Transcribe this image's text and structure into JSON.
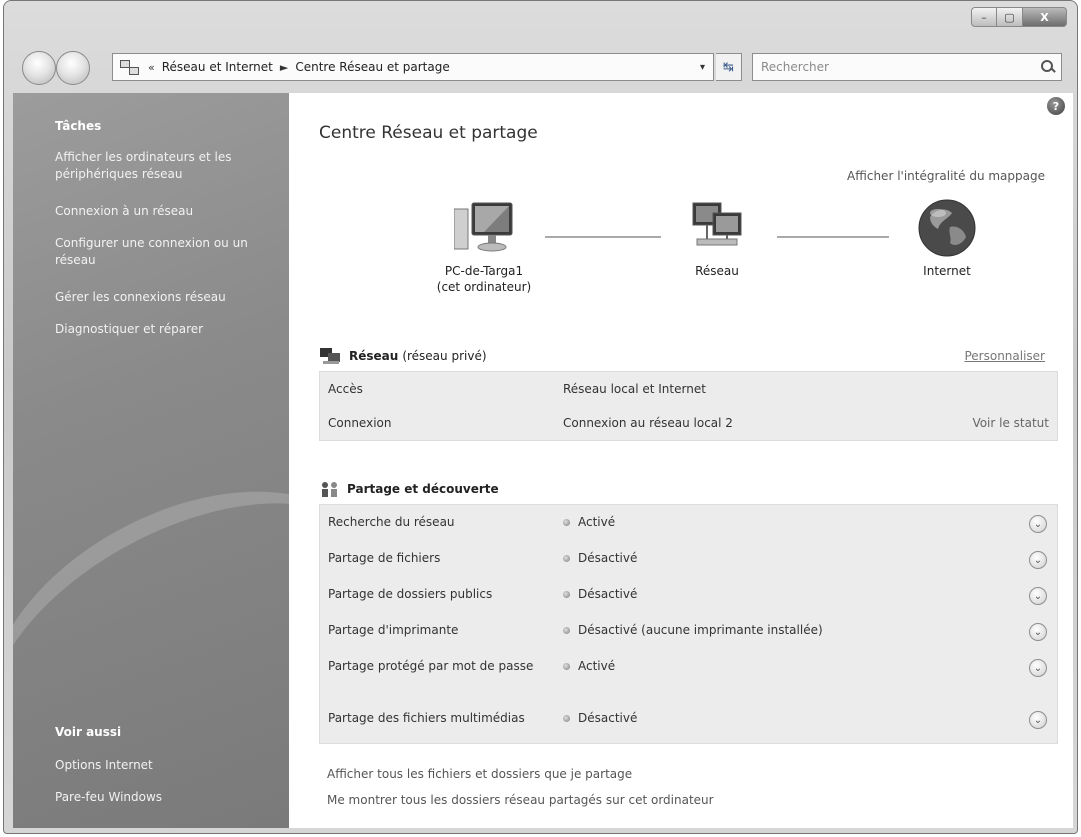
{
  "addressbar": {
    "crumbs_prefix": "«",
    "crumb1": "Réseau et Internet",
    "separator": "►",
    "crumb2": "Centre Réseau et partage",
    "dropdown": "▾",
    "refresh": "↹"
  },
  "search": {
    "placeholder": "Rechercher"
  },
  "window_controls": {
    "minimize": "–",
    "maximize": "▢",
    "close": "X"
  },
  "sidebar": {
    "tasks_heading": "Tâches",
    "tasks": [
      "Afficher les ordinateurs et les périphériques réseau",
      "Connexion à un réseau",
      "Configurer une connexion ou un réseau",
      "Gérer les connexions réseau",
      "Diagnostiquer et réparer"
    ],
    "see_also_heading": "Voir aussi",
    "see_also": [
      "Options Internet",
      "Pare-feu Windows"
    ]
  },
  "main": {
    "help": "?",
    "title": "Centre Réseau et partage",
    "full_map_link": "Afficher l'intégralité du mappage",
    "map": {
      "computer_line1": "PC-de-Targa1",
      "computer_line2": "(cet ordinateur)",
      "network": "Réseau",
      "internet": "Internet"
    },
    "network_section": {
      "name": "Réseau",
      "type": "(réseau privé)",
      "customize": "Personnaliser",
      "rows": [
        {
          "label": "Accès",
          "value": "Réseau local et Internet"
        },
        {
          "label": "Connexion",
          "value": "Connexion au réseau local 2",
          "action": "Voir le statut"
        }
      ]
    },
    "sharing_section": {
      "title": "Partage et découverte",
      "rows": [
        {
          "label": "Recherche du réseau",
          "value": "Activé"
        },
        {
          "label": "Partage de fichiers",
          "value": "Désactivé"
        },
        {
          "label": "Partage de dossiers publics",
          "value": "Désactivé"
        },
        {
          "label": "Partage d'imprimante",
          "value": "Désactivé (aucune imprimante installée)"
        },
        {
          "label": "Partage protégé par mot de passe",
          "value": "Activé"
        },
        {
          "label": "Partage des fichiers multimédias",
          "value": "Désactivé"
        }
      ]
    },
    "footer_links": [
      "Afficher tous les fichiers et dossiers que je partage",
      "Me montrer tous les dossiers réseau partagés sur cet ordinateur"
    ]
  }
}
